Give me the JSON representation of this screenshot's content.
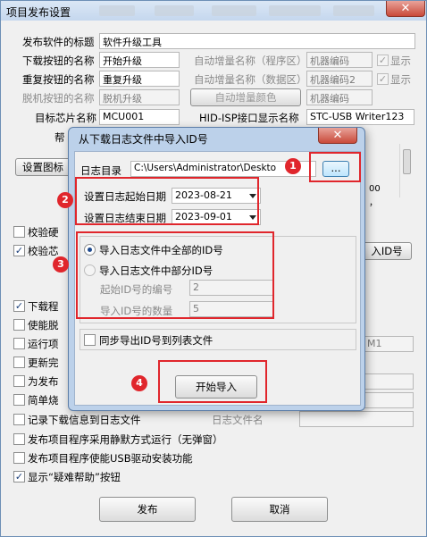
{
  "window": {
    "title": "项目发布设置",
    "close": "✕"
  },
  "rows": {
    "title_label": "发布软件的标题",
    "title_value": "软件升级工具",
    "download_label": "下载按钮的名称",
    "download_value": "开始升级",
    "auto_prog_label": "自动增量名称（程序区）",
    "auto_prog_value": "机器编码",
    "show": "显示",
    "repeat_label": "重复按钮的名称",
    "repeat_value": "重复升级",
    "auto_data_label": "自动增量名称（数据区）",
    "auto_data_value": "机器编码2",
    "offline_label": "脱机按钮的名称",
    "offline_value": "脱机升级",
    "auto_color_btn": "自动增量颜色",
    "offline_value2": "机器编码",
    "chip_label": "目标芯片名称",
    "chip_value": "MCU001",
    "hid_label": "HID-ISP接口显示名称",
    "hid_value": "STC-USB Writer123",
    "help_partial": "帮",
    "settings_btn": "设置图标",
    "verify_hw": "校验硬",
    "verify_chip": "校验芯",
    "import_id_btn": "入ID号",
    "download_prog": "下载程",
    "enable_offline": "使能脱",
    "run_proj": "运行项",
    "update_done": "更新完",
    "for_publish": "为发布",
    "simple_burn": "简单烧",
    "log_download": "记录下载信息到日志文件",
    "log_file_label": "日志文件名",
    "silent_run": "发布项目程序采用静默方式运行（无弹窗）",
    "usb_driver": "发布项目程序使能USB驱动安装功能",
    "show_help": "显示“疑难帮助”按钮",
    "right_frag1": "00",
    "right_frag2": "，",
    "right_frag3": "M1"
  },
  "buttons": {
    "publish": "发布",
    "cancel": "取消"
  },
  "dialog": {
    "title": "从下载日志文件中导入ID号",
    "close": "✕",
    "log_dir_label": "日志目录",
    "log_dir_value": "C:\\Users\\Administrator\\Deskto",
    "browse": "...",
    "start_date_label": "设置日志起始日期",
    "start_date": "2023-08-21",
    "end_date_label": "设置日志结束日期",
    "end_date": "2023-09-01",
    "import_all": "导入日志文件中全部的ID号",
    "import_part": "导入日志文件中部分ID号",
    "start_id_label": "起始ID号的编号",
    "start_id": "2",
    "count_label": "导入ID号的数量",
    "count": "5",
    "sync_export": "同步导出ID号到列表文件",
    "start_import": "开始导入"
  },
  "markers": [
    "1",
    "2",
    "3",
    "4"
  ],
  "colors": {
    "annotation_red": "#e0262c",
    "title_gradient": "#c5d7ee"
  }
}
